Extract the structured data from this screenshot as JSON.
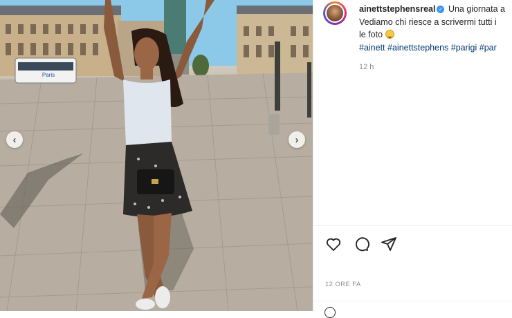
{
  "post": {
    "username": "ainettstephensreal",
    "caption_line1": "Una giornata a",
    "caption_line2": "Vediamo chi riesce a scrivermi tutti i",
    "caption_line3": "le foto",
    "hashtags": [
      "#ainett",
      "#ainettstephens",
      "#parigi",
      "#par"
    ],
    "caption_time": "12 h",
    "post_date": "12 ORE FA"
  },
  "photo": {
    "prev_arrow": "‹",
    "next_arrow": "›",
    "bus_sign": "Paris"
  },
  "colors": {
    "hashtag": "#00376b",
    "verified": "#3897f0",
    "muted": "#8e8e8e"
  },
  "icons": [
    "heart-icon",
    "comment-icon",
    "share-icon",
    "verified-icon",
    "smiley-icon",
    "chevron-left-icon",
    "chevron-right-icon"
  ]
}
